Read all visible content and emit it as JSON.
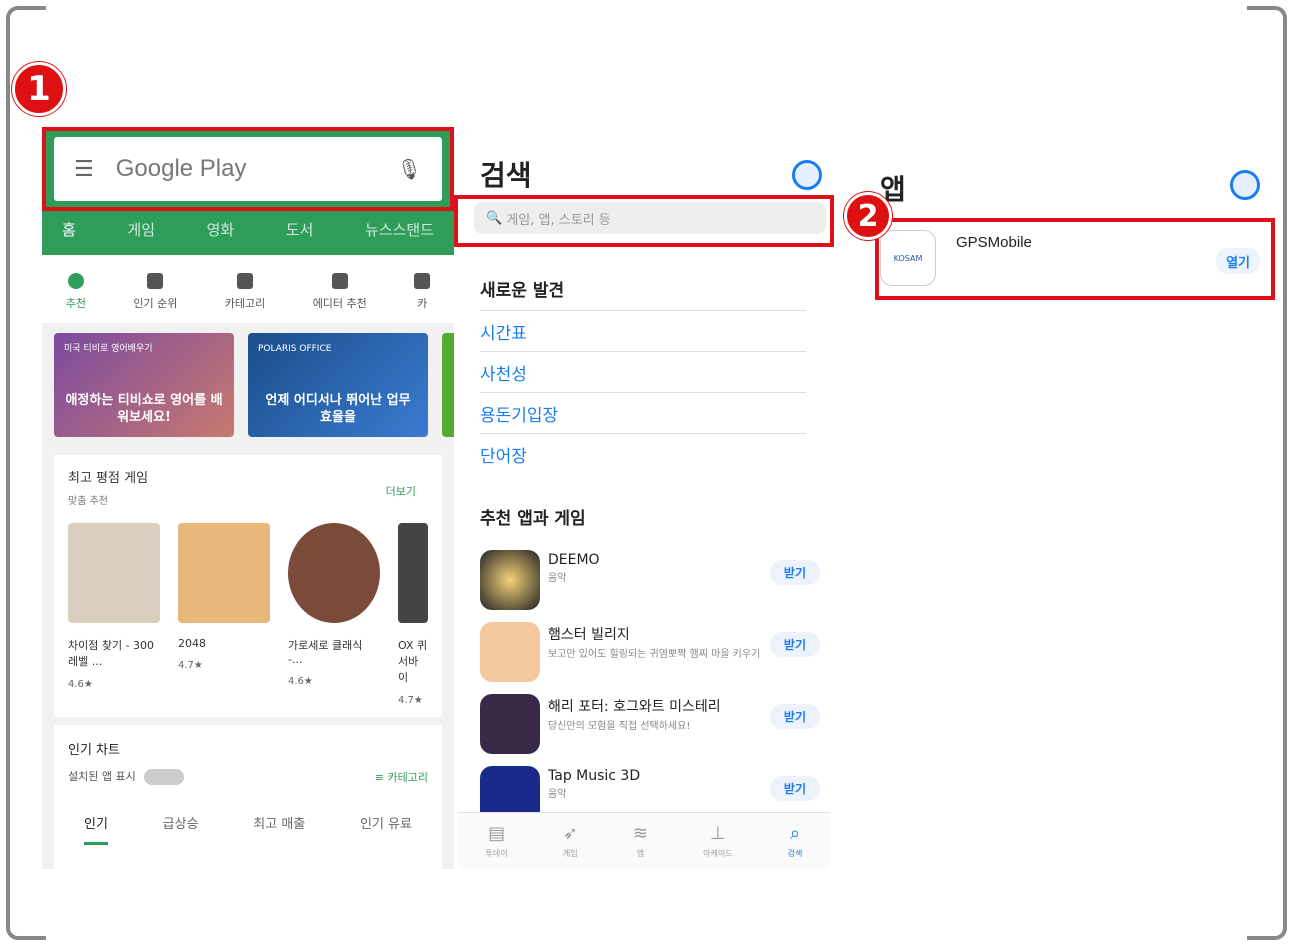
{
  "steps": {
    "one": "1",
    "two": "2"
  },
  "google_play": {
    "search_placeholder": "Google Play",
    "tabs": [
      "홈",
      "게임",
      "영화",
      "도서",
      "뉴스스탠드"
    ],
    "categories": [
      "추천",
      "인기 순위",
      "카테고리",
      "에디터 추천",
      "카"
    ],
    "banners": [
      {
        "tag": "미국 티비로 영어배우기",
        "text": "애정하는 티비쇼로 영어를 배워보세요!"
      },
      {
        "tag": "POLARIS OFFICE",
        "text": "언제 어디서나 뛰어난 업무 효율을"
      }
    ],
    "top_games": {
      "title": "최고 평점 게임",
      "subtitle": "맞춤 추천",
      "more": "더보기",
      "items": [
        {
          "name": "차이점 찾기 - 300 레벨 ...",
          "rating": "4.6★"
        },
        {
          "name": "2048",
          "rating": "4.7★"
        },
        {
          "name": "가로세로 클래식 -...",
          "rating": "4.6★"
        },
        {
          "name": "OX 퀴 서바이",
          "rating": "4.7★"
        }
      ]
    },
    "charts": {
      "title": "인기 차트",
      "installed_label": "설치된 앱 표시",
      "category_link": "카테고리",
      "tabs": [
        "인기",
        "급상승",
        "최고 매출",
        "인기 유료"
      ]
    }
  },
  "app_store": {
    "title": "검색",
    "search_placeholder": "게임, 앱, 스토리 등",
    "discover_title": "새로운 발견",
    "discover_items": [
      "시간표",
      "사천성",
      "용돈기입장",
      "단어장"
    ],
    "suggested_title": "추천 앱과 게임",
    "apps": [
      {
        "name": "DEEMO",
        "desc": "음악",
        "button": "받기"
      },
      {
        "name": "햄스터 빌리지",
        "desc": "보고만 있어도 힐링되는 귀염뽀짝 햄찌 마을 키우기",
        "button": "받기"
      },
      {
        "name": "해리 포터: 호그와트 미스테리",
        "desc": "당신만의 모험을 직접 선택하세요!",
        "button": "받기"
      },
      {
        "name": "Tap Music 3D",
        "desc": "음악",
        "button": "받기"
      }
    ],
    "tabbar": [
      "투데이",
      "게임",
      "앱",
      "아케이드",
      "검색"
    ]
  },
  "app_result": {
    "title": "앱",
    "app_name": "GPSMobile",
    "icon_text": "KOSAM",
    "button": "열기"
  }
}
